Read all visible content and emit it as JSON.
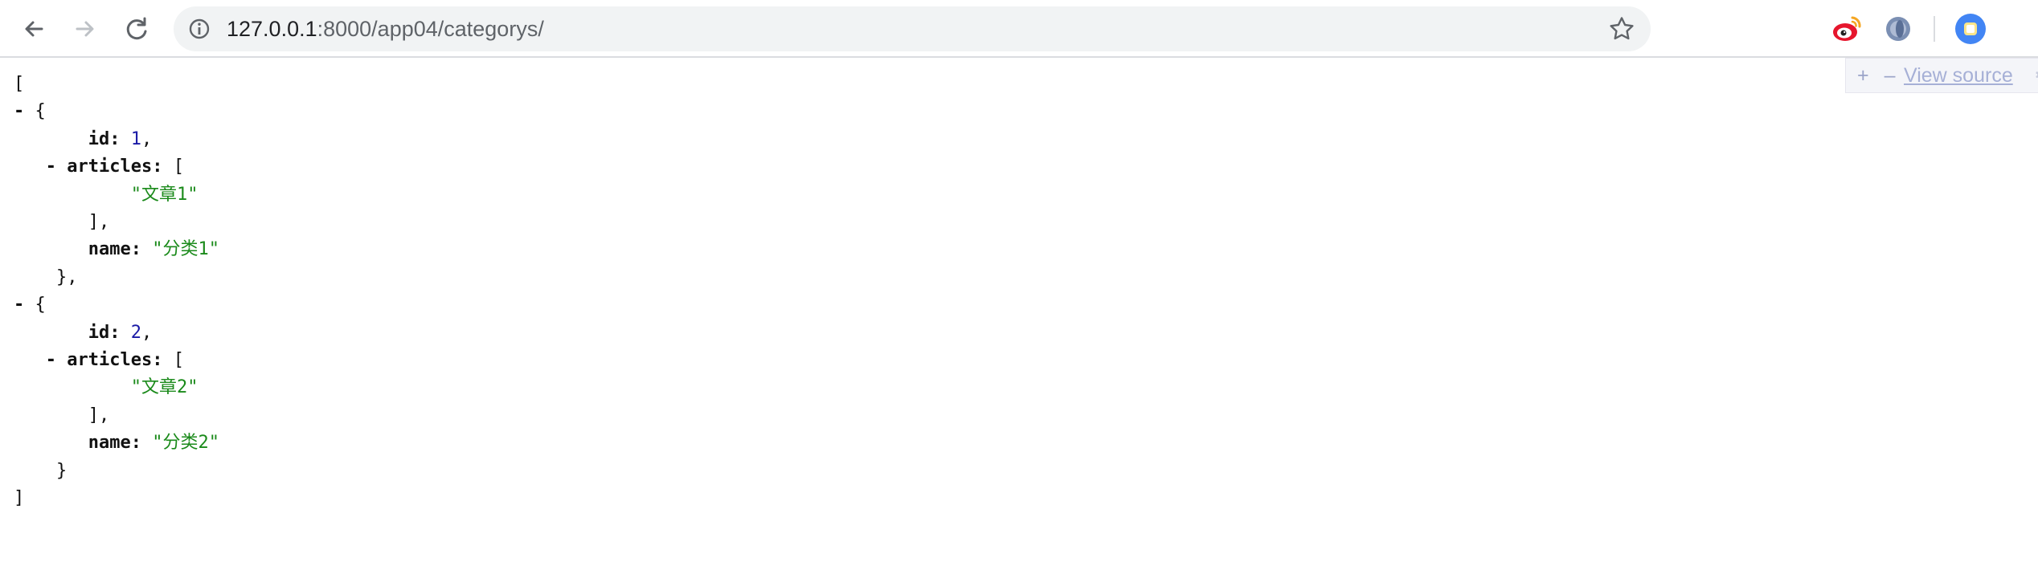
{
  "browser": {
    "url_host": "127.0.0.1",
    "url_rest": ":8000/app04/categorys/",
    "icons": {
      "back": "arrow-left-icon",
      "forward": "arrow-right-icon",
      "reload": "reload-icon",
      "info": "info-icon",
      "bookmark": "star-icon",
      "ext1": "weibo-icon",
      "ext2": "extension-icon",
      "profile": "profile-avatar-icon"
    }
  },
  "json_viewer": {
    "toolbar": {
      "expand": "+",
      "collapse": "–",
      "view_source": "View source",
      "options": "⚙"
    },
    "lines": [
      {
        "indent": 0,
        "collapser": "",
        "key": "",
        "value": "",
        "vtype": "",
        "tail": "["
      },
      {
        "indent": 2,
        "collapser": "- ",
        "key": "",
        "value": "",
        "vtype": "",
        "tail": "{"
      },
      {
        "indent": 7,
        "collapser": "",
        "key": "id",
        "value": "1",
        "vtype": "num",
        "tail": ","
      },
      {
        "indent": 5,
        "collapser": "- ",
        "key": "articles",
        "value": "",
        "vtype": "",
        "tail": "["
      },
      {
        "indent": 11,
        "collapser": "",
        "key": "",
        "value": "\"文章1\"",
        "vtype": "str",
        "tail": ""
      },
      {
        "indent": 7,
        "collapser": "",
        "key": "",
        "value": "",
        "vtype": "",
        "tail": "],"
      },
      {
        "indent": 7,
        "collapser": "",
        "key": "name",
        "value": "\"分类1\"",
        "vtype": "str",
        "tail": ""
      },
      {
        "indent": 4,
        "collapser": "",
        "key": "",
        "value": "",
        "vtype": "",
        "tail": "},"
      },
      {
        "indent": 2,
        "collapser": "- ",
        "key": "",
        "value": "",
        "vtype": "",
        "tail": "{"
      },
      {
        "indent": 7,
        "collapser": "",
        "key": "id",
        "value": "2",
        "vtype": "num",
        "tail": ","
      },
      {
        "indent": 5,
        "collapser": "- ",
        "key": "articles",
        "value": "",
        "vtype": "",
        "tail": "["
      },
      {
        "indent": 11,
        "collapser": "",
        "key": "",
        "value": "\"文章2\"",
        "vtype": "str",
        "tail": ""
      },
      {
        "indent": 7,
        "collapser": "",
        "key": "",
        "value": "",
        "vtype": "",
        "tail": "],"
      },
      {
        "indent": 7,
        "collapser": "",
        "key": "name",
        "value": "\"分类2\"",
        "vtype": "str",
        "tail": ""
      },
      {
        "indent": 4,
        "collapser": "",
        "key": "",
        "value": "",
        "vtype": "",
        "tail": "}"
      },
      {
        "indent": 0,
        "collapser": "",
        "key": "",
        "value": "",
        "vtype": "",
        "tail": "]"
      }
    ]
  },
  "colors": {
    "number": "#1a1aa6",
    "string": "#1a8a1a",
    "omnibox_bg": "#f1f3f4"
  }
}
